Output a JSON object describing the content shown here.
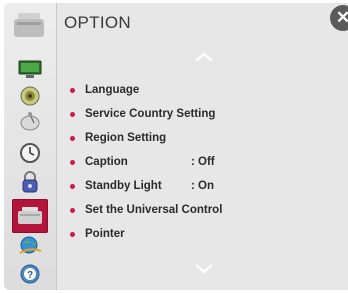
{
  "header": {
    "title": "OPTION"
  },
  "menu": {
    "items": [
      {
        "label": "Language",
        "value": ""
      },
      {
        "label": "Service Country Setting",
        "value": ""
      },
      {
        "label": "Region Setting",
        "value": ""
      },
      {
        "label": "Caption",
        "value": ": Off"
      },
      {
        "label": "Standby Light",
        "value": ": On"
      },
      {
        "label": "Set the Universal Control",
        "value": ""
      },
      {
        "label": "Pointer",
        "value": ""
      }
    ]
  },
  "sidebar": {
    "icons": [
      "picture-icon",
      "sound-icon",
      "channel-icon",
      "time-icon",
      "lock-icon",
      "option-icon",
      "network-icon",
      "support-icon"
    ],
    "selected": "option-icon"
  },
  "colors": {
    "accent": "#b3143a",
    "bullet": "#d6164a"
  }
}
